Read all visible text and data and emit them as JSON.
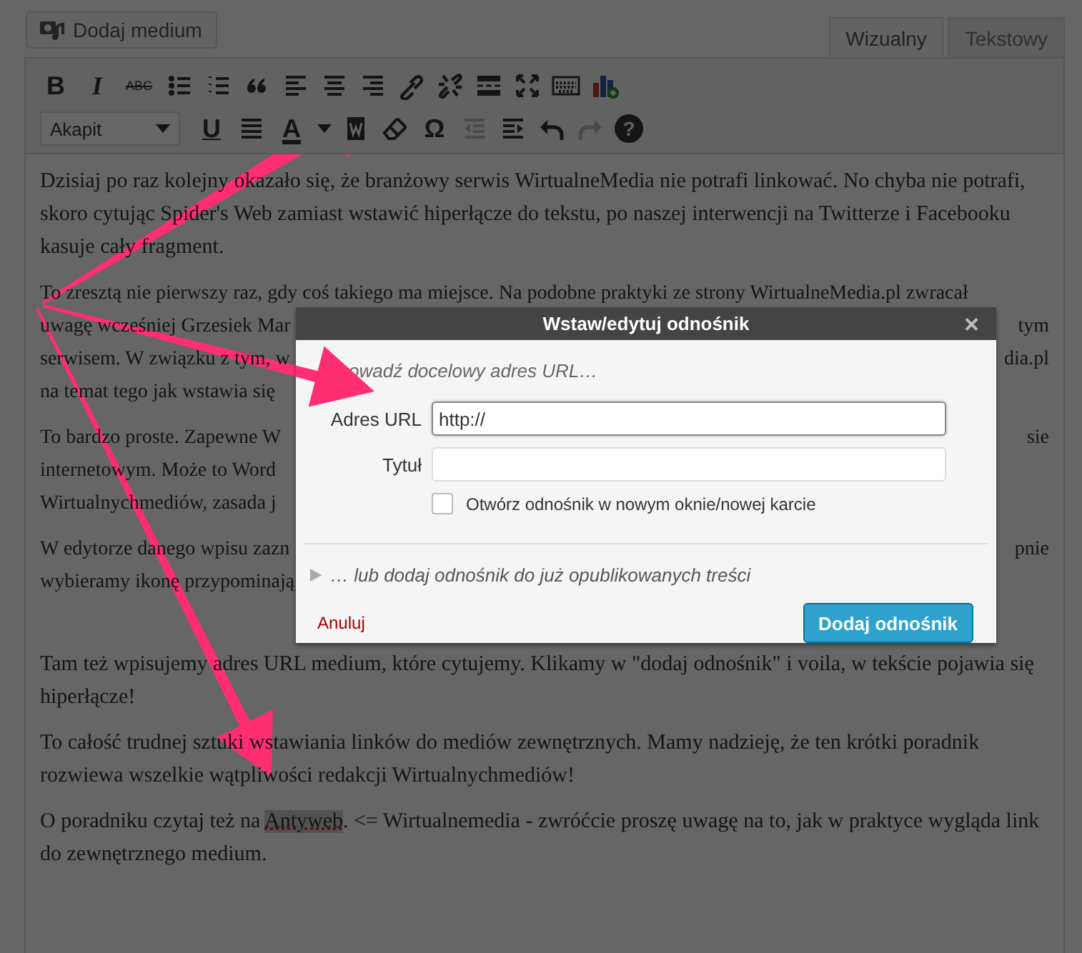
{
  "media_button": {
    "label": "Dodaj medium"
  },
  "editor_tabs": [
    {
      "label": "Wizualny",
      "selected": true
    },
    {
      "label": "Tekstowy",
      "selected": false
    }
  ],
  "toolbar_top": [
    {
      "kind": "bold",
      "glyph": "B",
      "disabled": false
    },
    {
      "kind": "italic",
      "glyph": "I",
      "disabled": false
    },
    {
      "kind": "strikethrough",
      "glyph": "ABC",
      "disabled": false
    },
    {
      "kind": "bullet-list",
      "disabled": false
    },
    {
      "kind": "numbered-list",
      "disabled": false
    },
    {
      "kind": "blockquote",
      "disabled": false
    },
    {
      "kind": "align-left",
      "disabled": false
    },
    {
      "kind": "align-center",
      "disabled": false
    },
    {
      "kind": "align-right",
      "disabled": false
    },
    {
      "kind": "link",
      "disabled": false
    },
    {
      "kind": "unlink",
      "disabled": false
    },
    {
      "kind": "read-more",
      "disabled": false
    },
    {
      "kind": "fullscreen",
      "disabled": false
    },
    {
      "kind": "keyboard",
      "disabled": false
    },
    {
      "kind": "chart",
      "disabled": false
    }
  ],
  "toolbar_bottom": [
    {
      "kind": "format-select",
      "glyph": "Akapit",
      "disabled": false
    },
    {
      "kind": "underline",
      "glyph": "U",
      "disabled": false
    },
    {
      "kind": "justify",
      "disabled": false
    },
    {
      "kind": "text-color",
      "glyph": "A",
      "disabled": false
    },
    {
      "kind": "paste-word",
      "disabled": false
    },
    {
      "kind": "eraser",
      "disabled": false
    },
    {
      "kind": "special-char",
      "glyph": "Ω",
      "disabled": false
    },
    {
      "kind": "outdent",
      "disabled": true
    },
    {
      "kind": "indent",
      "disabled": false
    },
    {
      "kind": "undo",
      "disabled": false
    },
    {
      "kind": "redo",
      "disabled": true
    },
    {
      "kind": "help",
      "glyph": "?",
      "disabled": false
    }
  ],
  "content": {
    "paragraphs": [
      {
        "kind": "text",
        "text": "Dzisiaj po raz kolejny okazało się, że branżowy serwis WirtualneMedia nie potrafi linkować. No chyba nie potrafi, skoro cytując Spider's Web zamiast wstawić hiperłącze do tekstu, po naszej interwencji na Twitterze i Facebooku kasuje cały fragment."
      },
      {
        "kind": "lines",
        "lines": [
          {
            "left": "To zresztą nie pierwszy raz, gdy coś takiego ma miejsce. Na podobne praktyki ze strony WirtualneMedia.pl zwracał"
          },
          {
            "left": "uwagę wcześniej Grzesiek Mar",
            "right": "tym"
          },
          {
            "left": "serwisem. W związku z tym, w",
            "right": "dia.pl"
          },
          {
            "left": "na temat tego jak wstawia się"
          }
        ]
      },
      {
        "kind": "lines",
        "lines": [
          {
            "left": "To bardzo proste. Zapewne W",
            "right": "sie"
          },
          {
            "left": "internetowym. Może to Word"
          },
          {
            "left": "Wirtualnychmediów, zasada j"
          }
        ]
      },
      {
        "kind": "lines",
        "lines": [
          {
            "left": "W edytorze danego wpisu zazn",
            "right": "pnie"
          },
          {
            "left": "wybieramy ikonę przypominają"
          }
        ]
      },
      {
        "kind": "text",
        "text": "Tam też wpisujemy adres URL medium, które cytujemy. Klikamy w \"dodaj odnośnik\" i voila, w tekście pojawia się hiperłącze!"
      },
      {
        "kind": "text",
        "text": "To całość trudnej sztuki wstawiania linków do mediów zewnętrznych. Mamy nadzieję, że ten krótki poradnik rozwiewa wszelkie wątpliwości redakcji Wirtualnychmediów!"
      },
      {
        "kind": "link",
        "before": "O poradniku czytaj też na ",
        "link": "Antyweb",
        "after": ". <= Wirtualnemedia - zwróćcie proszę uwagę na to, jak w praktyce wygląda link do zewnętrznego medium."
      }
    ]
  },
  "dialog": {
    "title": "Wstaw/edytuj odnośnik",
    "close": "×",
    "prompt": "owadź docelowy adres URL…",
    "url_label": "Adres URL",
    "url_value": "http://",
    "title_label": "Tytuł",
    "new_tab": {
      "label": "Otwórz odnośnik w nowym oknie/nowej karcie",
      "checked": false
    },
    "existing": {
      "label": "… lub dodaj odnośnik do już opublikowanych treści",
      "expanded": false
    },
    "cancel": "Anuluj",
    "submit": "Dodaj odnośnik"
  }
}
